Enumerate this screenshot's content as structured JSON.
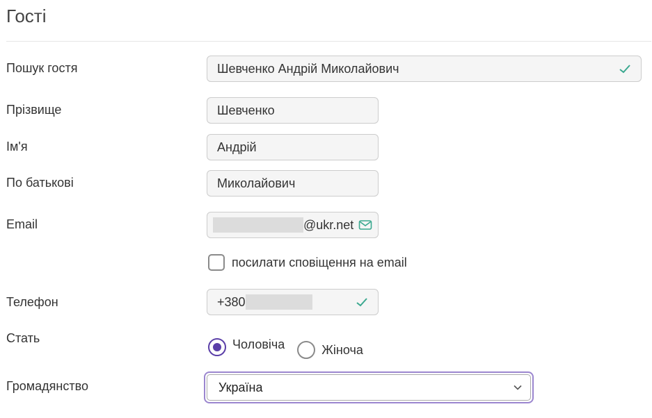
{
  "page": {
    "title": "Гості"
  },
  "form": {
    "search_guest": {
      "label": "Пошук гостя",
      "value": "Шевченко Андрій Миколайович"
    },
    "last_name": {
      "label": "Прізвище",
      "value": "Шевченко"
    },
    "first_name": {
      "label": "Ім'я",
      "value": "Андрій"
    },
    "patronymic": {
      "label": "По батькові",
      "value": "Миколайович"
    },
    "email": {
      "label": "Email",
      "value_suffix": "@ukr.net"
    },
    "notify": {
      "label": "посилати сповіщення на email",
      "checked": false
    },
    "phone": {
      "label": "Телефон",
      "value_prefix": "+380"
    },
    "gender": {
      "label": "Стать",
      "options": [
        "Чоловіча",
        "Жіноча"
      ],
      "selected": "Чоловіча"
    },
    "citizenship": {
      "label": "Громадянство",
      "value": "Україна"
    }
  },
  "colors": {
    "accent": "#5b3fa8",
    "focus_ring": "#9b86cf",
    "valid": "#3aa88f"
  },
  "icons": {
    "valid": "checkmark-icon",
    "email": "envelope-icon",
    "dropdown": "chevron-down-icon"
  }
}
